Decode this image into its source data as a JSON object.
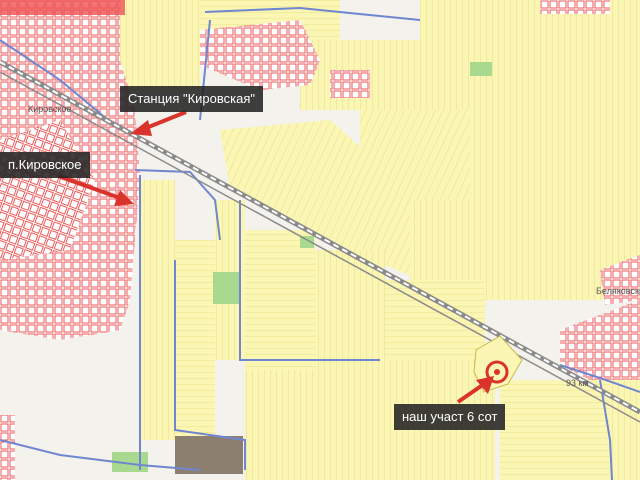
{
  "map": {
    "callouts": {
      "station": "Станция \"Кировская\"",
      "village": "п.Кировское",
      "plot": "наш участ 6 сот"
    },
    "map_labels": {
      "kirovskoe_small": "Кировское",
      "right_settlement": "Беляковский",
      "road_km": "93 км"
    },
    "colors": {
      "field_fill": "#fbf6b4",
      "field_line": "#e2da7c",
      "settlement_plot": "#ee5a5a",
      "road": "#6f86d0",
      "railway": "#8a8a8a",
      "callout_bg": "#232323",
      "arrow": "#d9332c",
      "plot_marker": "#d9332c",
      "green_area": "#a9d98e",
      "dark_block": "#8d7f6f"
    }
  }
}
